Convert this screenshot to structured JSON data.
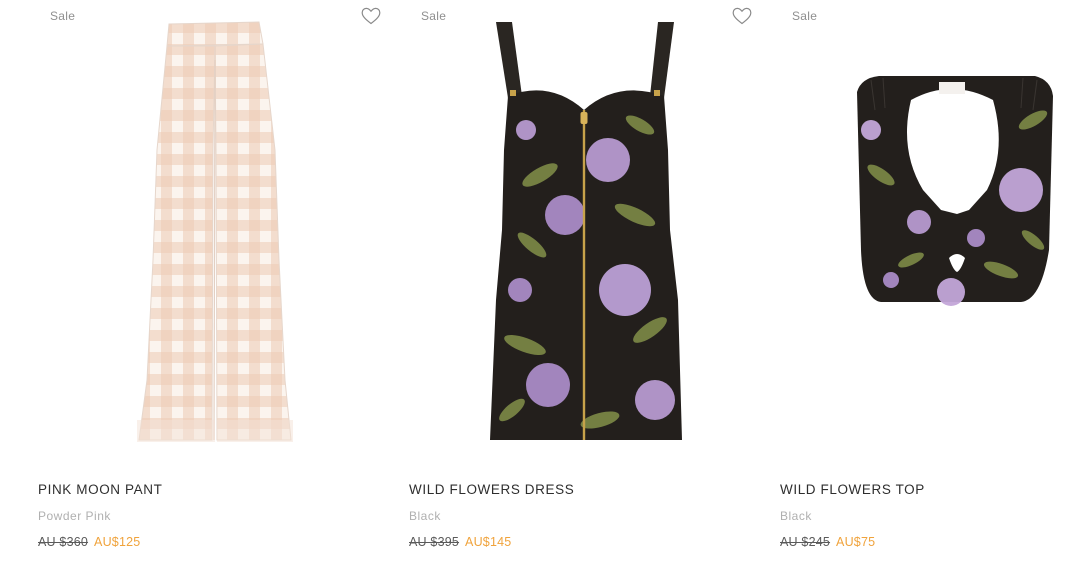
{
  "products": [
    {
      "badge": "Sale",
      "name": "PINK MOON PANT",
      "color": "Powder Pink",
      "old_price": "AU $360",
      "sale_price": "AU$125",
      "image_icon": "gingham-pant-image"
    },
    {
      "badge": "Sale",
      "name": "WILD FLOWERS DRESS",
      "color": "Black",
      "old_price": "AU $395",
      "sale_price": "AU$145",
      "image_icon": "floral-dress-image"
    },
    {
      "badge": "Sale",
      "name": "WILD FLOWERS TOP",
      "color": "Black",
      "old_price": "AU $245",
      "sale_price": "AU$75",
      "image_icon": "floral-top-image"
    }
  ],
  "colors": {
    "sale_price": "#f0a33c",
    "muted": "#b0b0b0",
    "badge": "#8f8f8f"
  }
}
